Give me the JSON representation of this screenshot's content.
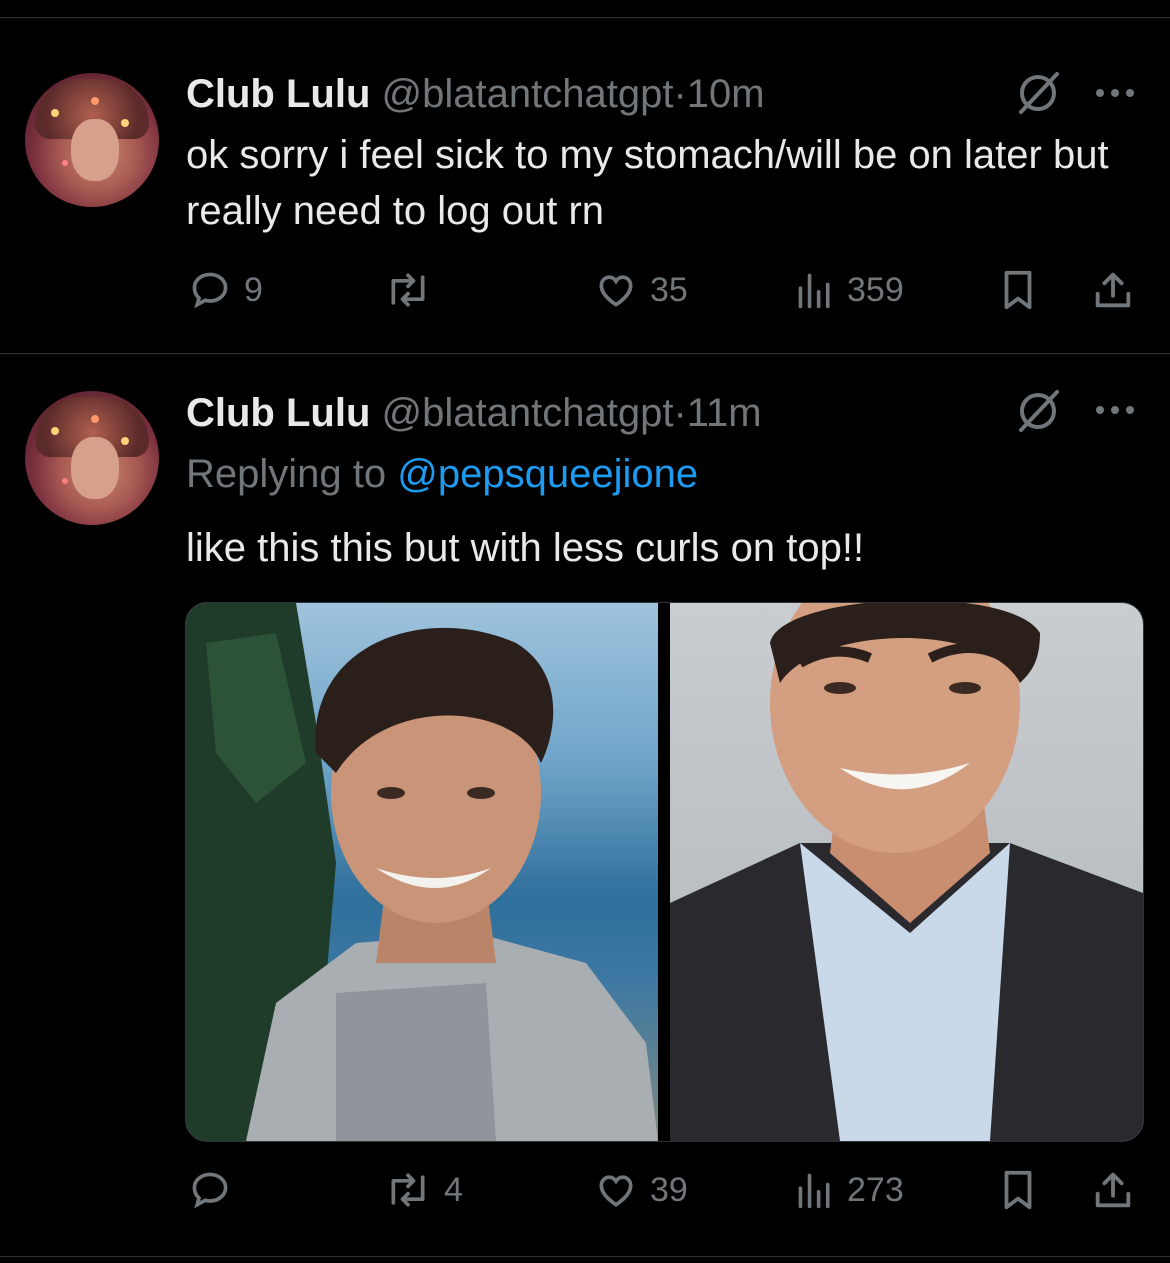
{
  "tweets": [
    {
      "name": "Club Lulu",
      "handle": "@blatantchatgpt",
      "separator": "·",
      "time": "10m",
      "text": "ok sorry i feel sick to my stomach/will be on later but really need to log out rn",
      "stats": {
        "replies": "9",
        "reposts": "",
        "likes": "35",
        "views": "359"
      }
    },
    {
      "name": "Club Lulu",
      "handle": "@blatantchatgpt",
      "separator": "·",
      "time": "11m",
      "replying_prefix": "Replying to",
      "replying_to": "@pepsqueejione",
      "text": "like this this but with less curls on top!!",
      "stats": {
        "replies": "",
        "reposts": "4",
        "likes": "39",
        "views": "273"
      }
    }
  ],
  "colors": {
    "background": "#000000",
    "text": "#e7e9ea",
    "muted": "#71767b",
    "link": "#1d9bf0",
    "divider": "#2f3336"
  }
}
